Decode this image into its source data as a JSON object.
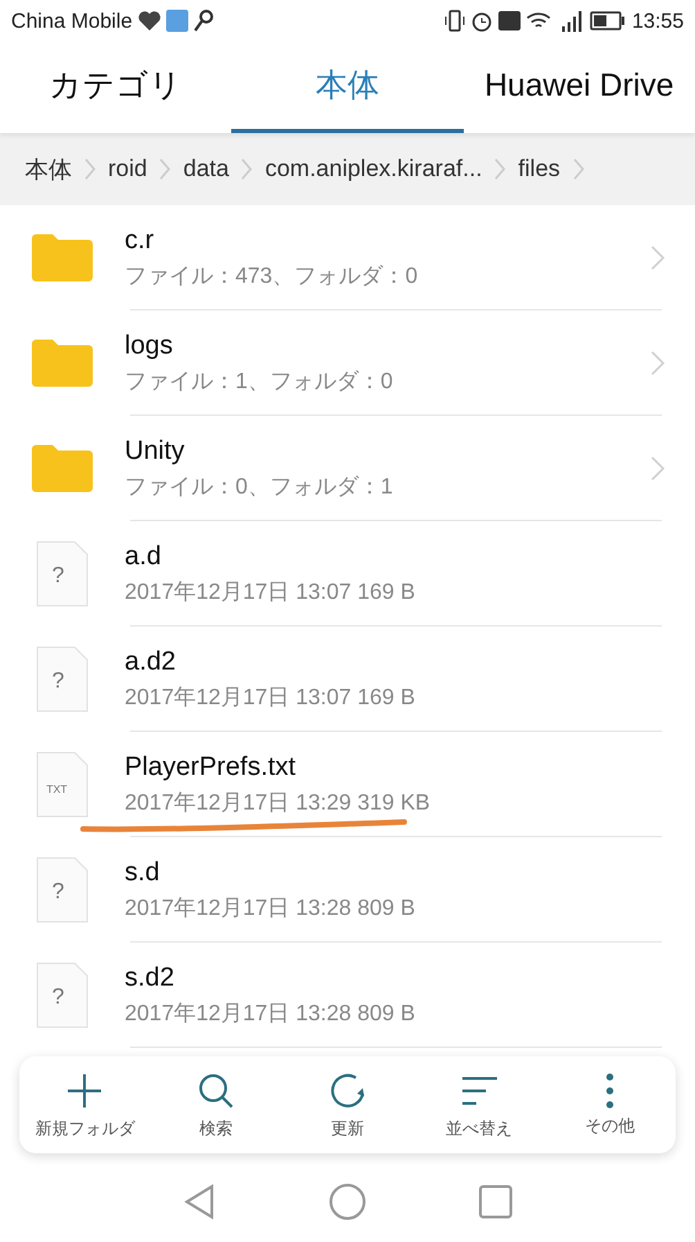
{
  "status_bar": {
    "carrier": "China Mobile",
    "time": "13:55"
  },
  "tabs": [
    {
      "label": "カテゴリ",
      "selected": false
    },
    {
      "label": "本体",
      "selected": true
    },
    {
      "label": "Huawei Drive",
      "selected": false
    }
  ],
  "breadcrumb": [
    "本体",
    "roid",
    "data",
    "com.aniplex.kiraraf...",
    "files"
  ],
  "files": [
    {
      "kind": "folder",
      "name": "c.r",
      "detail": "ファイル：473、フォルダ：0"
    },
    {
      "kind": "folder",
      "name": "logs",
      "detail": "ファイル：1、フォルダ：0"
    },
    {
      "kind": "folder",
      "name": "Unity",
      "detail": "ファイル：0、フォルダ：1"
    },
    {
      "kind": "unknown",
      "name": "a.d",
      "icon_label": "?",
      "detail": "2017年12月17日 13:07 169 B"
    },
    {
      "kind": "unknown",
      "name": "a.d2",
      "icon_label": "?",
      "detail": "2017年12月17日 13:07 169 B"
    },
    {
      "kind": "text",
      "name": "PlayerPrefs.txt",
      "icon_label": "TXT",
      "detail": "2017年12月17日 13:29 319 KB",
      "marked": true
    },
    {
      "kind": "unknown",
      "name": "s.d",
      "icon_label": "?",
      "detail": "2017年12月17日 13:28 809 B"
    },
    {
      "kind": "unknown",
      "name": "s.d2",
      "icon_label": "?",
      "detail": "2017年12月17日 13:28 809 B"
    }
  ],
  "toolbar": [
    {
      "kind": "add",
      "label": "新規フォルダ"
    },
    {
      "kind": "search",
      "label": "検索"
    },
    {
      "kind": "refresh",
      "label": "更新"
    },
    {
      "kind": "sort",
      "label": "並べ替え"
    },
    {
      "kind": "more",
      "label": "その他"
    }
  ]
}
